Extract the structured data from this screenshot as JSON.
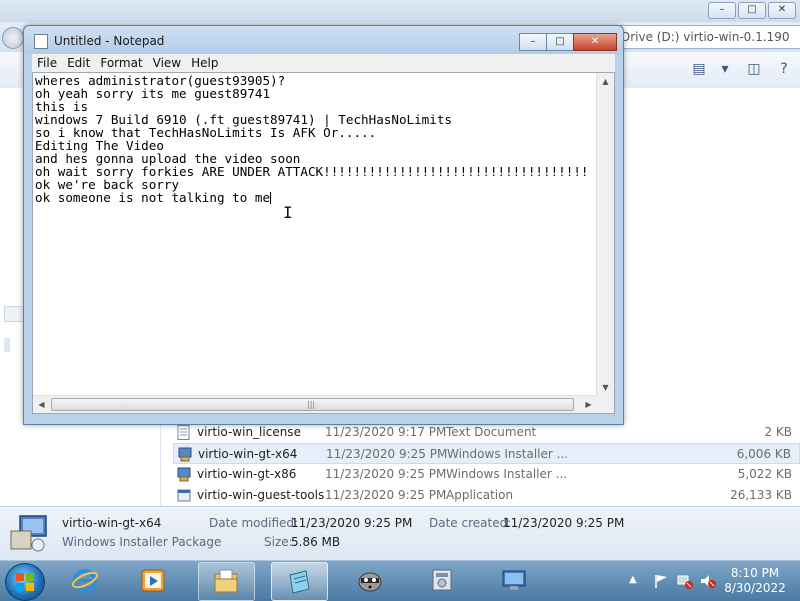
{
  "explorer": {
    "address": "Drive (D:) virtio-win-0.1.190",
    "window_controls": [
      "–",
      "□",
      "✕"
    ],
    "files": [
      {
        "name": "virtio-win_license",
        "date": "11/23/2020 9:17 PM",
        "type": "Text Document",
        "size": "2 KB",
        "icon": "text-file-icon"
      },
      {
        "name": "virtio-win-gt-x64",
        "date": "11/23/2020 9:25 PM",
        "type": "Windows Installer ...",
        "size": "6,006 KB",
        "icon": "installer-icon"
      },
      {
        "name": "virtio-win-gt-x86",
        "date": "11/23/2020 9:25 PM",
        "type": "Windows Installer ...",
        "size": "5,022 KB",
        "icon": "installer-icon"
      },
      {
        "name": "virtio-win-guest-tools",
        "date": "11/23/2020 9:25 PM",
        "type": "Application",
        "size": "26,133 KB",
        "icon": "application-icon"
      }
    ],
    "details": {
      "name": "virtio-win-gt-x64",
      "kind": "Windows Installer Package",
      "modified_label": "Date modified:",
      "modified_value": "11/23/2020 9:25 PM",
      "created_label": "Date created:",
      "created_value": "11/23/2020 9:25 PM",
      "size_label": "Size:",
      "size_value": "5.86 MB"
    }
  },
  "notepad": {
    "title": "Untitled - Notepad",
    "controls": {
      "minimize": "–",
      "maximize": "□",
      "close": "✕"
    },
    "menu": [
      "File",
      "Edit",
      "Format",
      "View",
      "Help"
    ],
    "lines": [
      "wheres administrator(guest93905)?",
      "oh yeah sorry its me guest89741",
      "this is",
      "windows 7 Build 6910 (.ft guest89741) | TechHasNoLimits",
      "so i know that TechHasNoLimits Is AFK Or.....",
      "Editing The Video",
      "and hes gonna upload the video soon",
      "oh wait sorry forkies ARE UNDER ATTACK!!!!!!!!!!!!!!!!!!!!!!!!!!!!!!!!!!!",
      "ok we're back sorry",
      "ok someone is not talking to me"
    ]
  },
  "taskbar": {
    "items": [
      "start-button",
      "internet-explorer",
      "media-player",
      "explorer",
      "notepad",
      "raccoon-app",
      "control-panel",
      "remote-desktop"
    ],
    "active_item": "notepad",
    "clock_time": "8:10 PM",
    "clock_date": "8/30/2022"
  }
}
